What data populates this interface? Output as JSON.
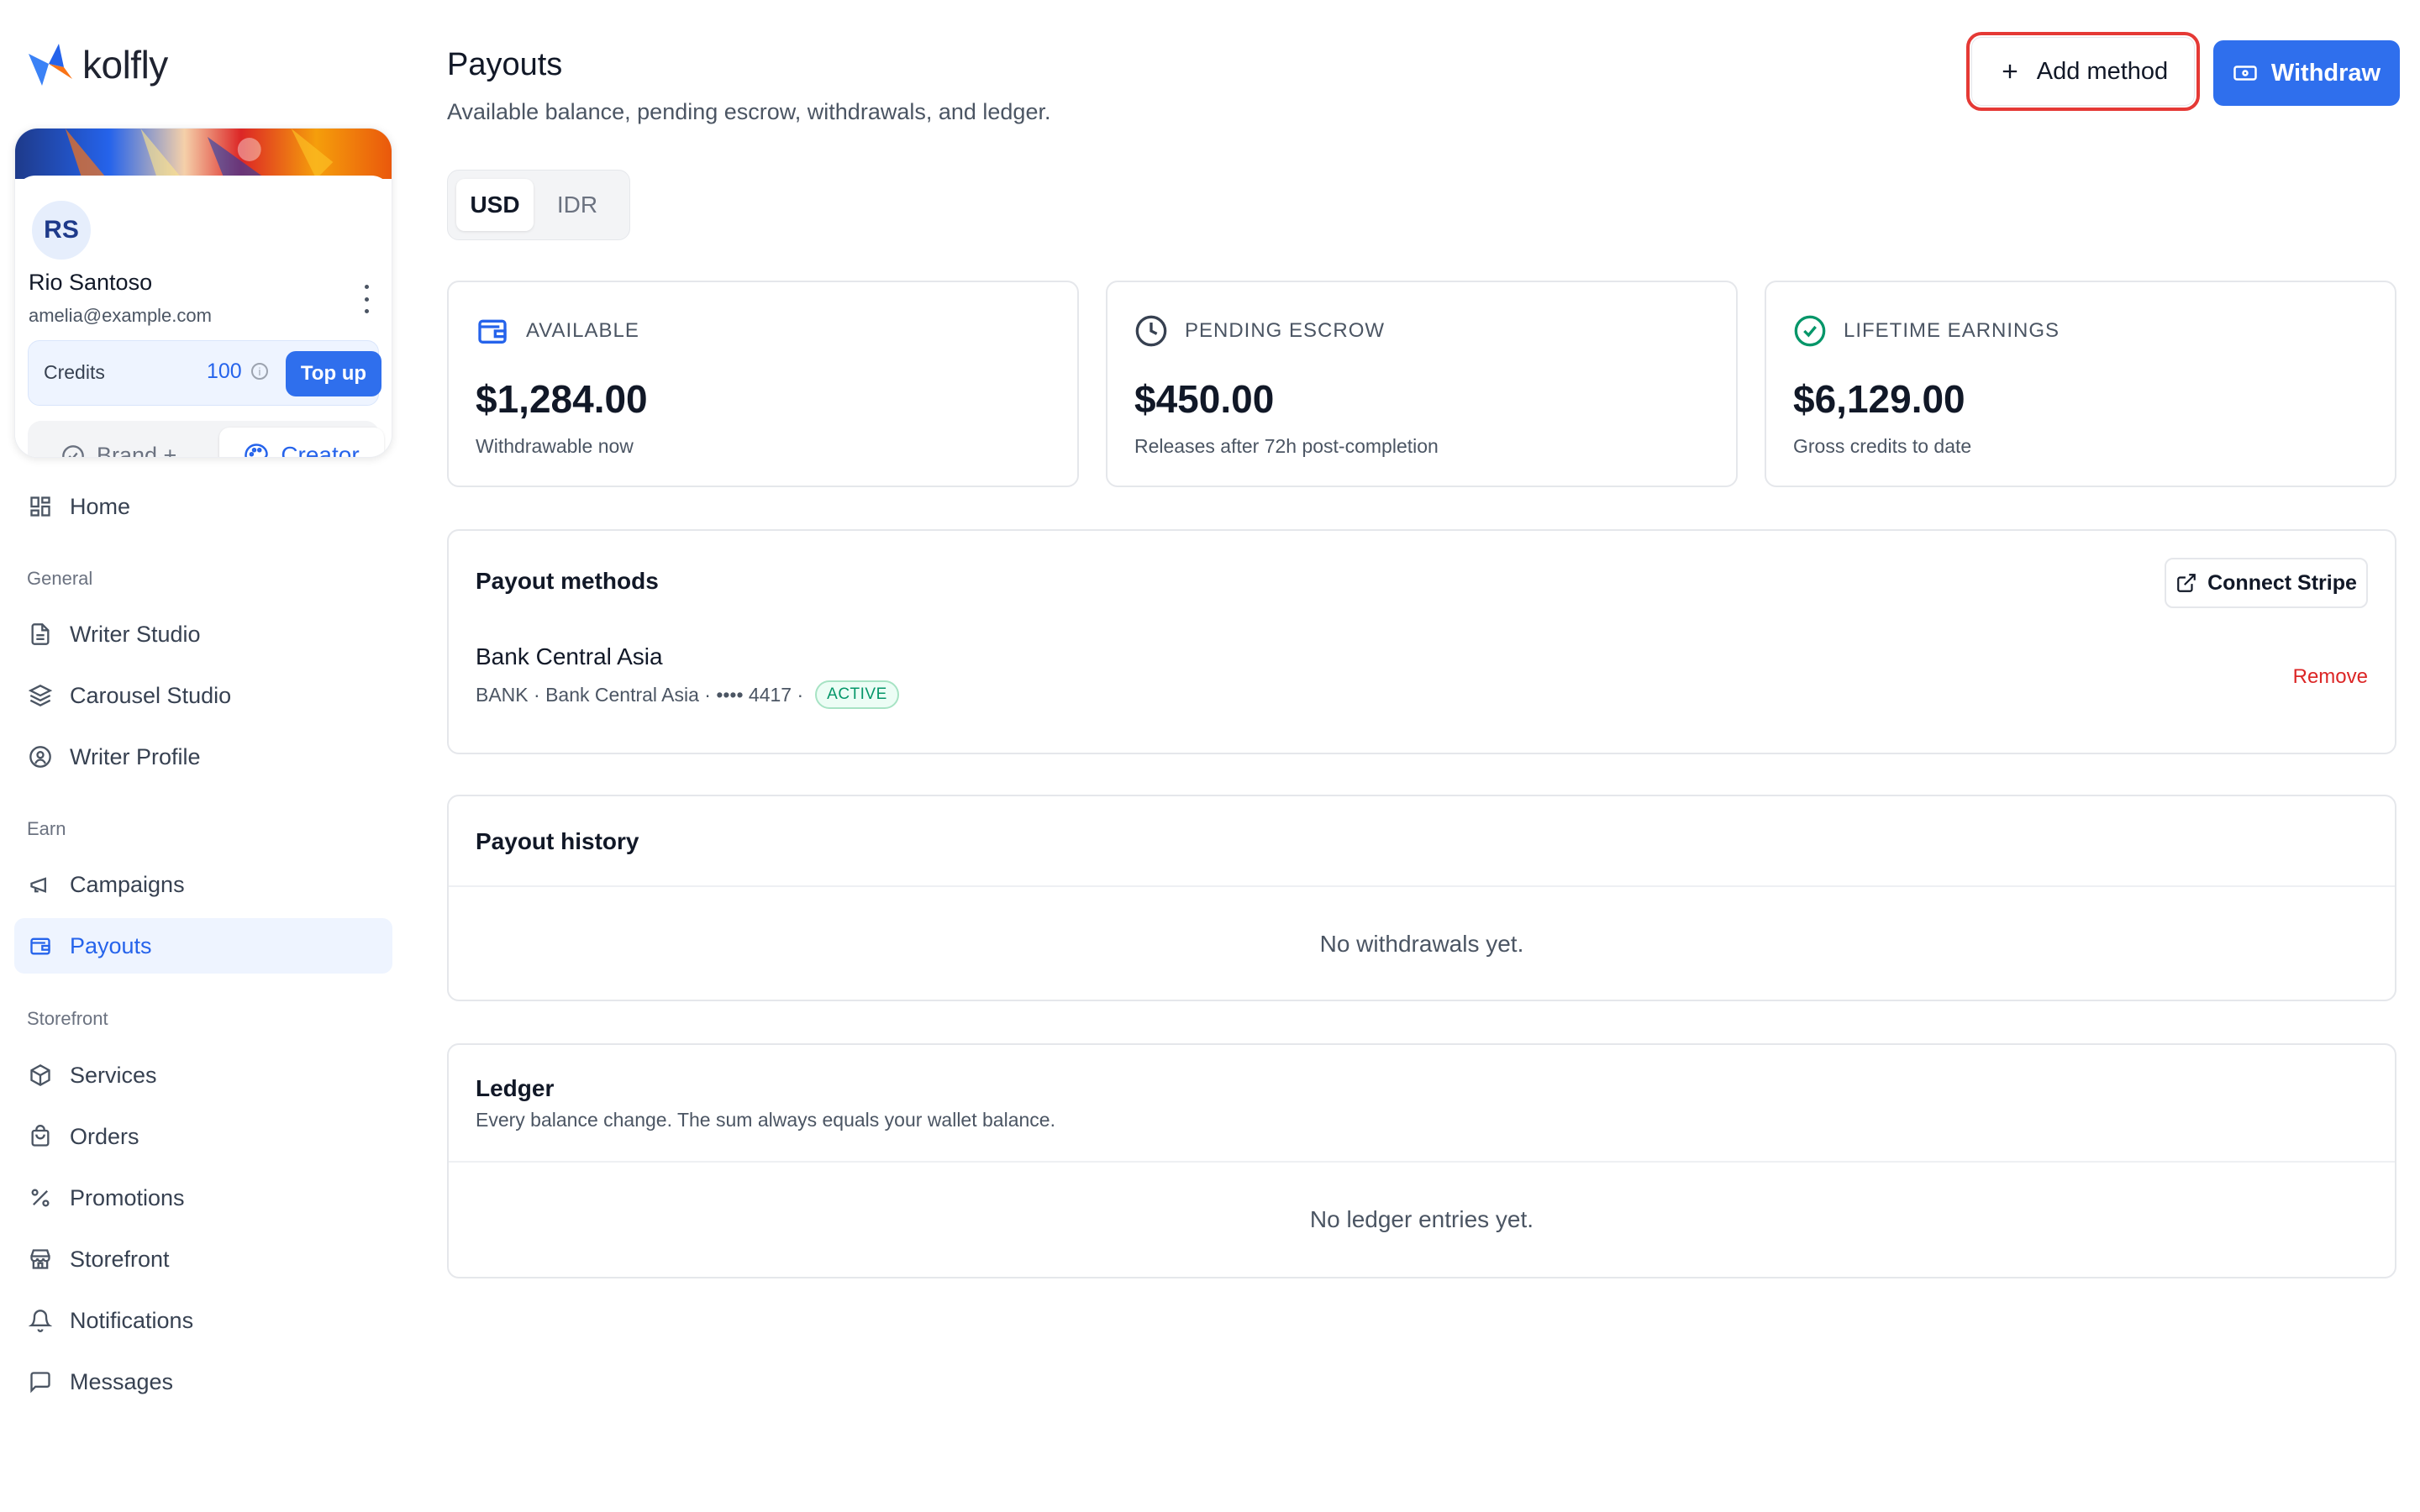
{
  "app": {
    "name": "kolfly"
  },
  "profile": {
    "initials": "RS",
    "name": "Rio Santoso",
    "email": "amelia@example.com",
    "credits_label": "Credits",
    "credits_value": "100",
    "topup_label": "Top up",
    "brand_label": "Brand +",
    "creator_label": "Creator"
  },
  "sidebar": {
    "home": "Home",
    "sections": {
      "general": "General",
      "earn": "Earn",
      "storefront": "Storefront"
    },
    "general_items": [
      "Writer Studio",
      "Carousel Studio",
      "Writer Profile"
    ],
    "earn_items": [
      "Campaigns",
      "Payouts"
    ],
    "storefront_items": [
      "Services",
      "Orders",
      "Promotions",
      "Storefront",
      "Notifications",
      "Messages"
    ],
    "active_item": "Payouts"
  },
  "page": {
    "title": "Payouts",
    "subtitle": "Available balance, pending escrow, withdrawals, and ledger.",
    "add_method_label": "Add method",
    "withdraw_label": "Withdraw"
  },
  "currency_tabs": {
    "selected": "USD",
    "items": [
      "USD",
      "IDR"
    ]
  },
  "stats": [
    {
      "label": "AVAILABLE",
      "value": "$1,284.00",
      "sub": "Withdrawable now",
      "icon": "wallet-icon"
    },
    {
      "label": "PENDING ESCROW",
      "value": "$450.00",
      "sub": "Releases after 72h post-completion",
      "icon": "clock-icon"
    },
    {
      "label": "LIFETIME EARNINGS",
      "value": "$6,129.00",
      "sub": "Gross credits to date",
      "icon": "check-circle-icon"
    }
  ],
  "payout_methods": {
    "title": "Payout methods",
    "connect_label": "Connect Stripe",
    "method": {
      "name": "Bank Central Asia",
      "meta": "BANK · Bank Central Asia · •••• 4417 ·",
      "status": "ACTIVE",
      "remove_label": "Remove"
    }
  },
  "payout_history": {
    "title": "Payout history",
    "empty": "No withdrawals yet."
  },
  "ledger": {
    "title": "Ledger",
    "subtitle": "Every balance change. The sum always equals your wallet balance.",
    "empty": "No ledger entries yet."
  },
  "colors": {
    "accent": "#2f6fed",
    "highlight": "#e53935",
    "danger": "#dc2626",
    "success": "#059669"
  }
}
